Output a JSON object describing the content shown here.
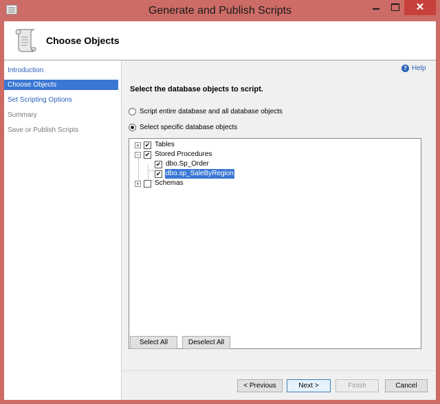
{
  "window": {
    "title": "Generate and Publish Scripts",
    "close_glyph": "✕"
  },
  "header": {
    "title": "Choose Objects"
  },
  "sidebar": {
    "items": [
      {
        "label": "Introduction"
      },
      {
        "label": "Choose Objects"
      },
      {
        "label": "Set Scripting Options"
      },
      {
        "label": "Summary"
      },
      {
        "label": "Save or Publish Scripts"
      }
    ]
  },
  "help": {
    "label": "Help",
    "icon_glyph": "?"
  },
  "main": {
    "section_title": "Select the database objects to script.",
    "options": [
      {
        "label": "Script entire database and all database objects",
        "checked": false
      },
      {
        "label": "Select specific database objects",
        "checked": true
      }
    ],
    "tree": {
      "nodes": [
        {
          "label": "Tables",
          "checked": true,
          "expander": "+"
        },
        {
          "label": "Stored Procedures",
          "checked": true,
          "expander": "−"
        },
        {
          "label": "dbo.Sp_Order",
          "checked": true
        },
        {
          "label": "dbo.sp_SaleByRegion",
          "checked": true,
          "selected": true
        },
        {
          "label": "Schemas",
          "checked": false,
          "expander": "+"
        }
      ],
      "check_glyph": "✔"
    },
    "select_all": "Select All",
    "deselect_all": "Deselect All"
  },
  "footer": {
    "previous": "< Previous",
    "next": "Next >",
    "finish": "Finish",
    "cancel": "Cancel"
  }
}
